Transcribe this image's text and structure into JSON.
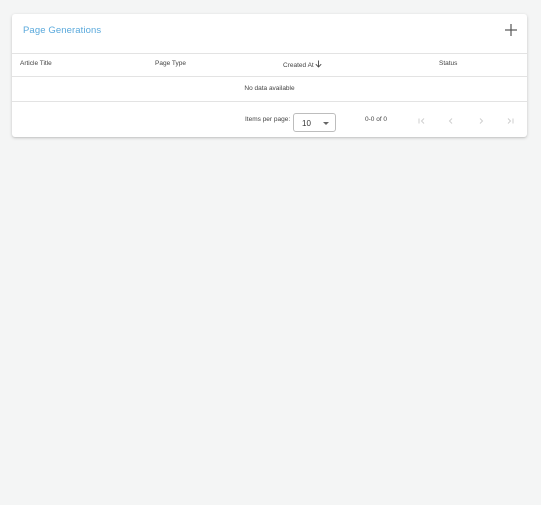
{
  "card": {
    "title": "Page Generations"
  },
  "table": {
    "columns": [
      "Article Title",
      "Page Type",
      "Created At",
      "Status"
    ],
    "sort": {
      "column": "Created At",
      "direction": "descending"
    },
    "empty_message": "No data available"
  },
  "paginator": {
    "items_per_page_label": "Items per page:",
    "items_per_page_value": "10",
    "range_label": "0-0 of 0",
    "buttons": [
      "first-page-icon",
      "previous-page-icon",
      "next-page-icon",
      "last-page-icon"
    ]
  },
  "colors": {
    "title": "#5aa9dc",
    "background": "#f4f5f5",
    "card": "#ffffff",
    "divider": "#e3e3e3",
    "disabled_icon": "#cfcfcf"
  },
  "icons": {
    "add": "add-icon",
    "sort": "arrow-down-icon",
    "select_caret": "caret-down-icon"
  }
}
